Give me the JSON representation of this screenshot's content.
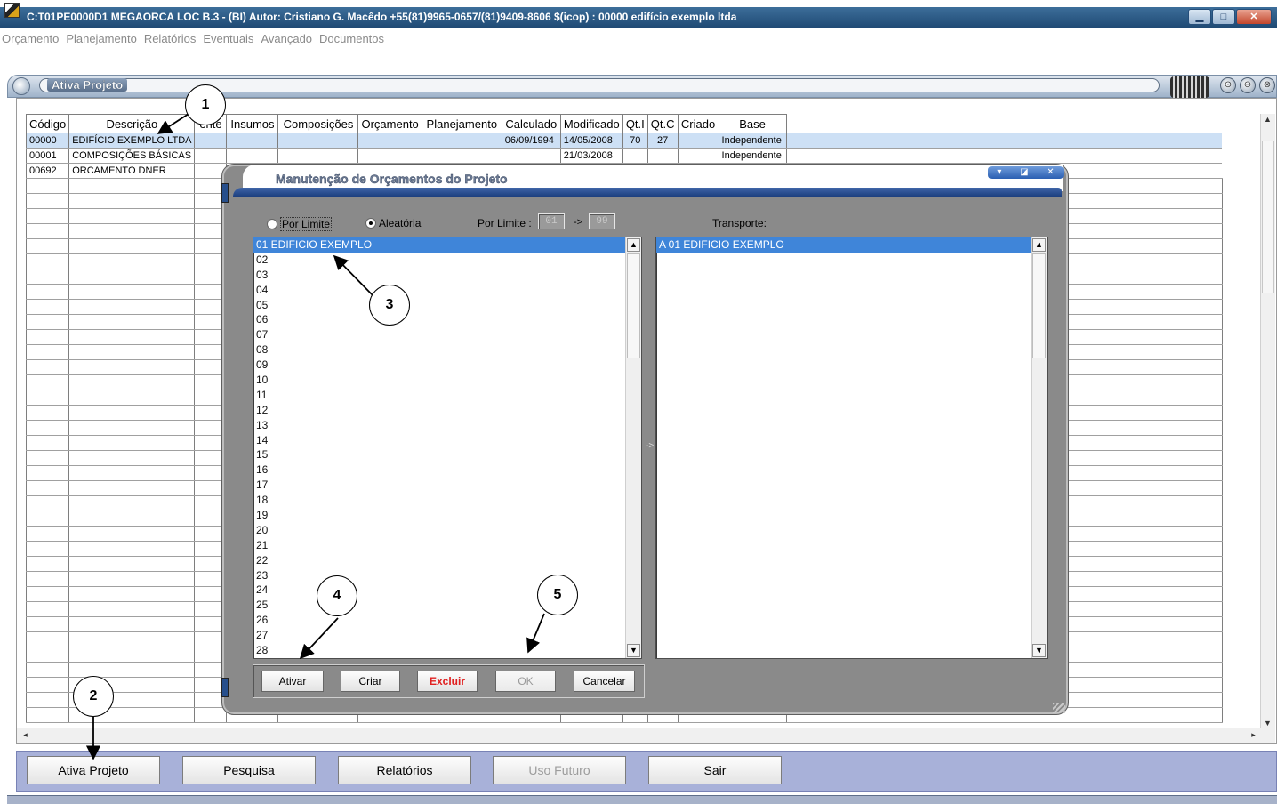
{
  "window": {
    "title": "C:T01PE0000D1 MEGAORCA LOC B.3 -  (BI) Autor: Cristiano G. Macêdo +55(81)9965-0657/(81)9409-8606  $(icop) : 00000 edifício exemplo ltda",
    "min_glyph": "▁",
    "max_glyph": "□",
    "close_glyph": "✕"
  },
  "menu": [
    "Orçamento",
    "Planejamento",
    "Relatórios",
    "Eventuais",
    "Avançado",
    "Documentos"
  ],
  "panel": {
    "title": "Ativa Projeto",
    "btn_glyphs": [
      "⊙",
      "⊖",
      "⊗"
    ]
  },
  "grid": {
    "columns": [
      "Código",
      "Descrição",
      "ente",
      "Insumos",
      "Composições",
      "Orçamento",
      "Planejamento",
      "Calculado",
      "Modificado",
      "Qt.I",
      "Qt.C",
      "Criado",
      "Base"
    ],
    "rows": [
      [
        "00000",
        "EDIFÍCIO EXEMPLO LTDA",
        "",
        "",
        "",
        "",
        "",
        "06/09/1994",
        "14/05/2008",
        "70",
        "27",
        "",
        "Independente"
      ],
      [
        "00001",
        "COMPOSIÇÕES BÁSICAS",
        "",
        "",
        "",
        "",
        "",
        "",
        "21/03/2008",
        "",
        "",
        "",
        "Independente"
      ],
      [
        "00692",
        "ORCAMENTO DNER",
        "",
        "",
        "",
        "",
        "",
        "",
        "",
        "",
        "",
        "",
        ""
      ]
    ],
    "empty_rows": 36
  },
  "toolbar": {
    "buttons": [
      {
        "label": "Ativa Projeto",
        "enabled": true
      },
      {
        "label": "Pesquisa",
        "enabled": true
      },
      {
        "label": "Relatórios",
        "enabled": true
      },
      {
        "label": "Uso Futuro",
        "enabled": false
      },
      {
        "label": "Sair",
        "enabled": true
      }
    ]
  },
  "modal": {
    "title": "Manutenção de Orçamentos do Projeto",
    "win_glyphs": [
      "▾",
      "◪",
      "✕"
    ],
    "radio_limit": "Por Limite",
    "radio_random": "Aleatória",
    "selected_mode": "Aleatória",
    "limit_label": "Por Limite :",
    "limit_from": "01",
    "limit_arrow": "->",
    "limit_to": "99",
    "transport_label": "Transporte:",
    "transfer_arrow": "->",
    "left_list": [
      "01 EDIFICIO EXEMPLO",
      "02",
      "03",
      "04",
      "05",
      "06",
      "07",
      "08",
      "09",
      "10",
      "11",
      "12",
      "13",
      "14",
      "15",
      "16",
      "17",
      "18",
      "19",
      "20",
      "21",
      "22",
      "23",
      "24",
      "25",
      "26",
      "27",
      "28"
    ],
    "left_selected_index": 0,
    "right_list": [
      "A 01 EDIFICIO EXEMPLO"
    ],
    "right_selected_index": 0,
    "buttons": {
      "activate": "Ativar",
      "create": "Criar",
      "delete": "Excluir",
      "ok": "OK",
      "cancel": "Cancelar"
    }
  },
  "annotations": [
    "1",
    "2",
    "3",
    "4",
    "5"
  ],
  "colors": {
    "selection": "#3f85d9",
    "row_highlight": "#cde0f5",
    "toolbar_bg": "#a8b1d9",
    "modal_bg": "#8a8a8a",
    "danger": "#e02020"
  }
}
